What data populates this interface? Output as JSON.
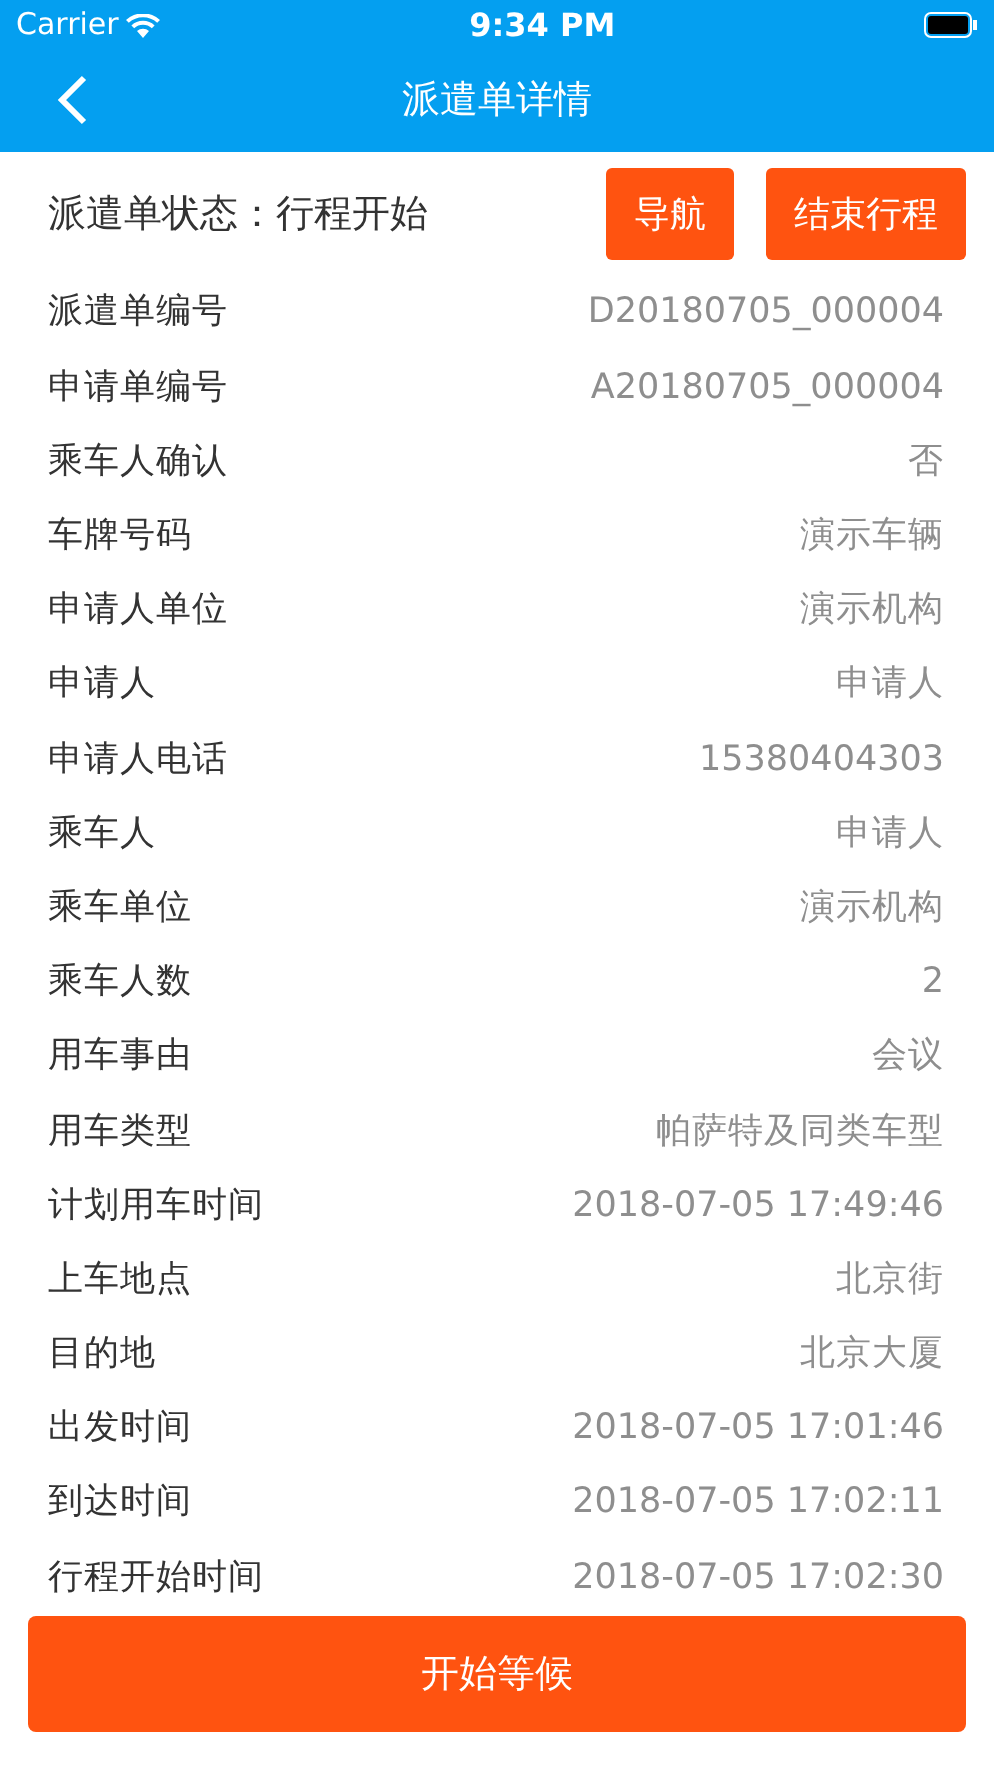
{
  "status_bar": {
    "carrier": "Carrier",
    "time": "9:34 PM"
  },
  "nav": {
    "title": "派遣单详情"
  },
  "header": {
    "status": "派遣单状态：行程开始",
    "buttons": [
      "导航",
      "结束行程"
    ]
  },
  "fields": [
    {
      "label": "派遣单编号",
      "value": "D20180705_000004"
    },
    {
      "label": "申请单编号",
      "value": "A20180705_000004"
    },
    {
      "label": "乘车人确认",
      "value": "否"
    },
    {
      "label": "车牌号码",
      "value": "演示车辆"
    },
    {
      "label": "申请人单位",
      "value": "演示机构"
    },
    {
      "label": "申请人",
      "value": "申请人"
    },
    {
      "label": "申请人电话",
      "value": "15380404303"
    },
    {
      "label": "乘车人",
      "value": "申请人"
    },
    {
      "label": "乘车单位",
      "value": "演示机构"
    },
    {
      "label": "乘车人数",
      "value": "2"
    },
    {
      "label": "用车事由",
      "value": "会议"
    },
    {
      "label": "用车类型",
      "value": "帕萨特及同类车型"
    },
    {
      "label": "计划用车时间",
      "value": "2018-07-05 17:49:46"
    },
    {
      "label": "上车地点",
      "value": "北京街"
    },
    {
      "label": "目的地",
      "value": "北京大厦"
    },
    {
      "label": "出发时间",
      "value": "2018-07-05 17:01:46"
    },
    {
      "label": "到达时间",
      "value": "2018-07-05 17:02:11"
    },
    {
      "label": "行程开始时间",
      "value": "2018-07-05 17:02:30"
    }
  ],
  "action_button": "开始等候"
}
